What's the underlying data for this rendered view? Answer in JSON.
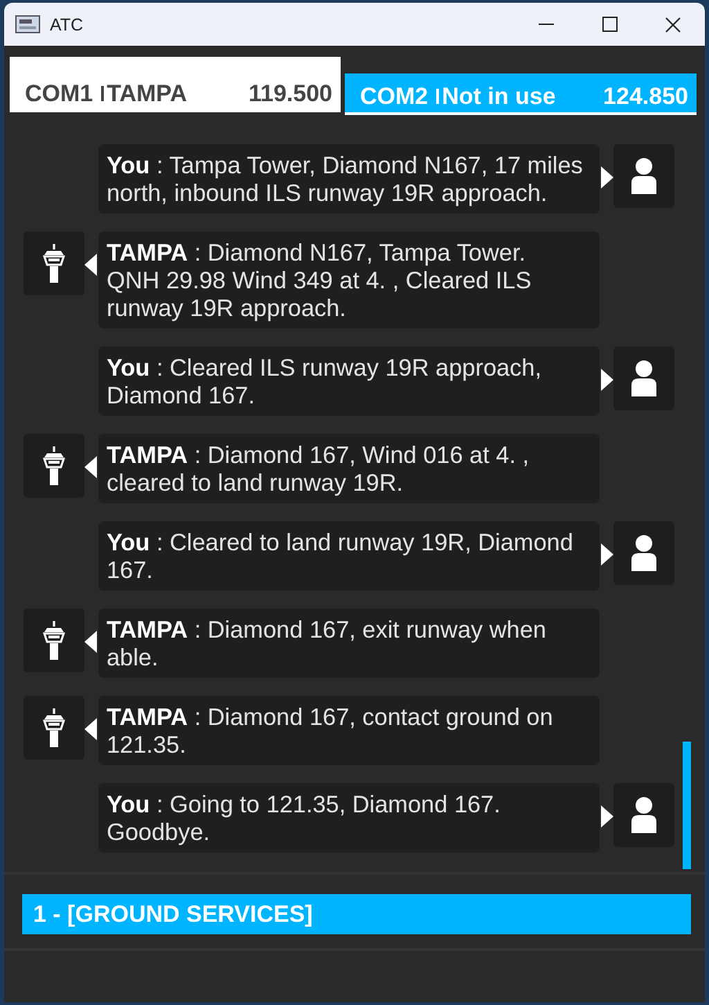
{
  "window": {
    "title": "ATC"
  },
  "tabs": [
    {
      "radio": "COM1",
      "station": "TAMPA",
      "frequency": "119.500",
      "selected": true
    },
    {
      "radio": "COM2",
      "station": "Not in use",
      "frequency": "124.850",
      "selected": false
    }
  ],
  "messages": [
    {
      "kind": "pilot",
      "text": "**You** : Tampa Tower, Diamond N167, 17 miles north, inbound ILS runway 19R approach."
    },
    {
      "kind": "atc",
      "text": "**TAMPA** : Diamond N167, Tampa Tower. QNH 29.98 Wind 349 at 4. , Cleared ILS runway 19R approach."
    },
    {
      "kind": "pilot",
      "text": "**You** : Cleared ILS runway 19R approach, Diamond 167."
    },
    {
      "kind": "atc",
      "text": "**TAMPA** : Diamond 167, Wind 016 at 4. , cleared to land runway 19R."
    },
    {
      "kind": "pilot",
      "text": "**You** : Cleared to land runway 19R, Diamond 167."
    },
    {
      "kind": "atc",
      "text": "**TAMPA** : Diamond 167, exit runway when able."
    },
    {
      "kind": "atc",
      "text": "**TAMPA** : Diamond 167, contact ground on 121.35."
    },
    {
      "kind": "pilot",
      "text": "**You** : Going to 121.35, Diamond 167. Goodbye."
    }
  ],
  "options": [
    {
      "label": "1 - [GROUND SERVICES]",
      "selected": true
    }
  ]
}
